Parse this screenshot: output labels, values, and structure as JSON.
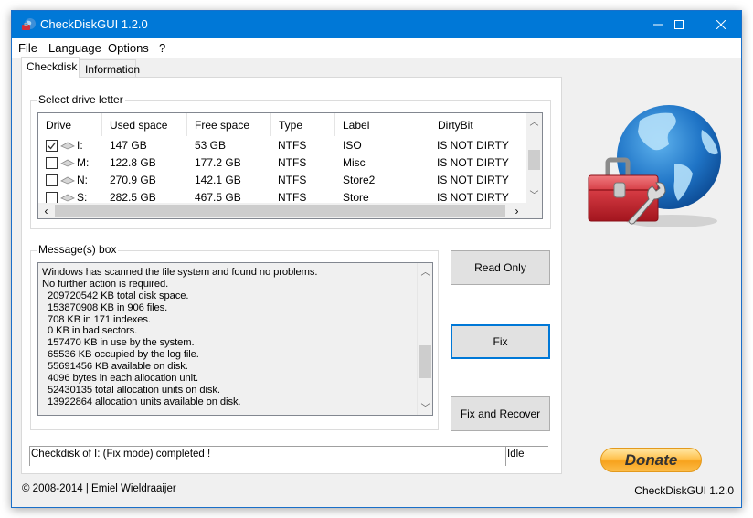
{
  "window": {
    "title": "CheckDiskGUI 1.2.0",
    "controls": {
      "minimize": "─",
      "maximize": "☐",
      "close": "✕"
    }
  },
  "menu": {
    "items": [
      "File",
      "Language",
      "Options",
      "?"
    ]
  },
  "tabs": [
    {
      "label": "Checkdisk",
      "active": true
    },
    {
      "label": "Information",
      "active": false
    }
  ],
  "drive_group": {
    "legend": "Select drive letter",
    "columns": [
      "Drive",
      "Used space",
      "Free space",
      "Type",
      "Label",
      "DirtyBit"
    ],
    "rows": [
      {
        "checked": true,
        "drive": "I:",
        "used": "147 GB",
        "free": "53 GB",
        "type": "NTFS",
        "label": "ISO",
        "dirty": "IS NOT DIRTY"
      },
      {
        "checked": false,
        "drive": "M:",
        "used": "122.8 GB",
        "free": "177.2 GB",
        "type": "NTFS",
        "label": "Misc",
        "dirty": "IS NOT DIRTY"
      },
      {
        "checked": false,
        "drive": "N:",
        "used": "270.9 GB",
        "free": "142.1 GB",
        "type": "NTFS",
        "label": "Store2",
        "dirty": "IS NOT DIRTY"
      },
      {
        "checked": false,
        "drive": "S:",
        "used": "282.5 GB",
        "free": "467.5 GB",
        "type": "NTFS",
        "label": "Store",
        "dirty": "IS NOT DIRTY"
      }
    ]
  },
  "message_group": {
    "legend": "Message(s) box",
    "lines": [
      "Windows has scanned the file system and found no problems.",
      "No further action is required.",
      "  209720542 KB total disk space.",
      "  153870908 KB in 906 files.",
      "  708 KB in 171 indexes.",
      "  0 KB in bad sectors.",
      "  157470 KB in use by the system.",
      "  65536 KB occupied by the log file.",
      "  55691456 KB available on disk.",
      "  4096 bytes in each allocation unit.",
      "  52430135 total allocation units on disk.",
      "  13922864 allocation units available on disk."
    ]
  },
  "buttons": {
    "read_only": "Read Only",
    "fix": "Fix",
    "fix_and_recover": "Fix and Recover",
    "donate": "Donate"
  },
  "status": {
    "message": "Checkdisk of I: (Fix mode) completed !",
    "state": "Idle"
  },
  "footer": {
    "copyright": "© 2008-2014 | Emiel Wieldraaijer",
    "version": "CheckDiskGUI 1.2.0"
  },
  "icons": {
    "app": "globe-toolbox-icon",
    "logo": "globe-toolbox-logo",
    "drive": "drive-icon",
    "scroll_up": "chevron-up-icon",
    "scroll_down": "chevron-down-icon",
    "scroll_left": "chevron-left-icon",
    "scroll_right": "chevron-right-icon"
  },
  "colors": {
    "titlebar": "#0078d7",
    "focus_border": "#0078d7",
    "donate_orange": "#f7a21c"
  }
}
